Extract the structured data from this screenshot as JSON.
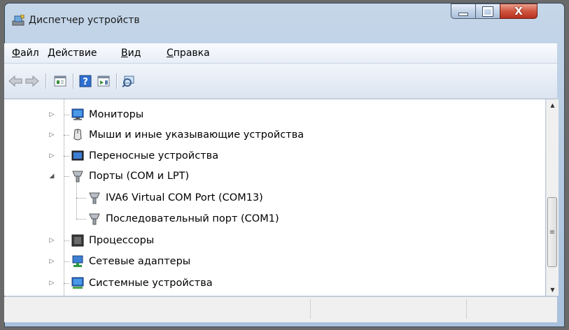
{
  "window": {
    "title": "Диспетчер устройств",
    "controls": {
      "minimize": "minimize",
      "maximize": "maximize",
      "close": "X"
    }
  },
  "menu": {
    "items": [
      {
        "accel": "Ф",
        "rest": "айл"
      },
      {
        "accel": "Д",
        "rest": "ействие"
      },
      {
        "accel": "В",
        "rest": "ид"
      },
      {
        "accel": "С",
        "rest": "правка"
      }
    ]
  },
  "toolbar": {
    "buttons": [
      "back-arrow-icon",
      "forward-arrow-icon",
      "properties-icon",
      "help-icon",
      "driver-details-icon",
      "scan-hardware-icon"
    ]
  },
  "tree": {
    "items": [
      {
        "label": "Мониторы",
        "icon": "monitor-icon",
        "state": "collapsed"
      },
      {
        "label": "Мыши и иные указывающие устройства",
        "icon": "mouse-icon",
        "state": "collapsed"
      },
      {
        "label": "Переносные устройства",
        "icon": "portable-device-icon",
        "state": "collapsed"
      },
      {
        "label": "Порты (COM и LPT)",
        "icon": "port-icon",
        "state": "expanded"
      },
      {
        "label": "IVA6 Virtual COM Port (COM13)",
        "icon": "port-icon",
        "state": "leaf"
      },
      {
        "label": "Последовательный порт (COM1)",
        "icon": "port-icon",
        "state": "leaf"
      },
      {
        "label": "Процессоры",
        "icon": "processor-icon",
        "state": "collapsed"
      },
      {
        "label": "Сетевые адаптеры",
        "icon": "network-adapter-icon",
        "state": "collapsed"
      },
      {
        "label": "Системные устройства",
        "icon": "system-device-icon",
        "state": "collapsed"
      }
    ]
  },
  "colors": {
    "title_bar": "#b9cde3",
    "close_button": "#d0553f",
    "content_bg": "#ffffff",
    "status_bar": "#f0f0f0"
  }
}
